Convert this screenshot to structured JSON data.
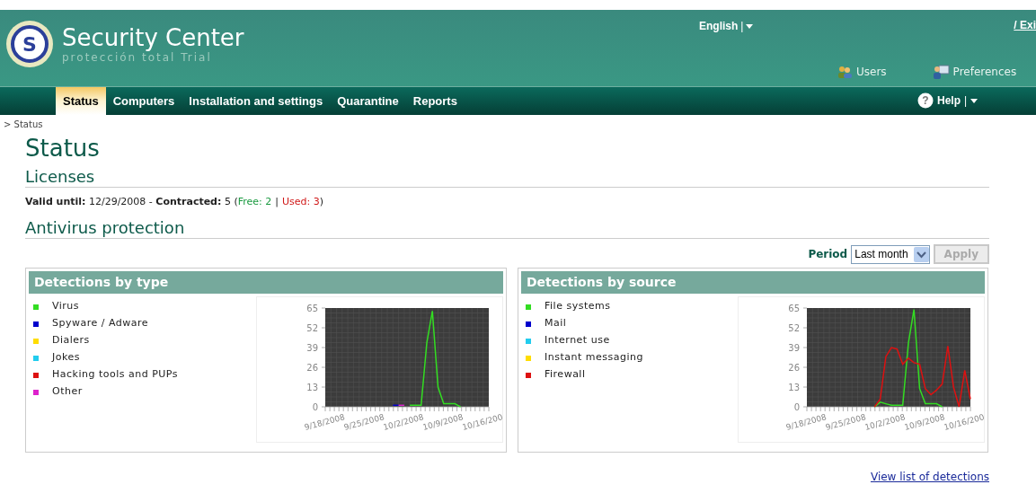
{
  "header": {
    "logo_letter": "S",
    "title": "Security Center",
    "subtitle": "protección total Trial",
    "language": "English",
    "language_separator": "|",
    "exit_link": "/ Exi",
    "tools": [
      {
        "label": "Users",
        "kind": "users"
      },
      {
        "label": "Preferences",
        "kind": "preferences"
      }
    ],
    "help_icon": "?",
    "help": "Help",
    "help_separator": "|"
  },
  "nav": [
    {
      "label": "Status",
      "selected": true
    },
    {
      "label": "Computers",
      "selected": false
    },
    {
      "label": "Installation and settings",
      "selected": false
    },
    {
      "label": "Quarantine",
      "selected": false
    },
    {
      "label": "Reports",
      "selected": false
    }
  ],
  "breadcrumb": "> Status",
  "page_title": "Status",
  "licenses": {
    "heading": "Licenses",
    "line": "**Valid until:** 12/29/2008 - **Contracted:** 5 (",
    "free": "Free: 2",
    "separator": "|",
    "used": "Used: 3",
    "close": ")"
  },
  "antivirus": {
    "heading": "Antivirus protection",
    "period_label": "Period",
    "period_value": "Last month",
    "apply": "Apply",
    "apply_disabled": true
  },
  "panels": [
    {
      "title": "Detections by type",
      "chart_data": {
        "type": "line",
        "categories": [
          "9/18/2008",
          null,
          null,
          null,
          null,
          null,
          null,
          "9/25/2008",
          null,
          null,
          null,
          null,
          null,
          null,
          "10/2/2008",
          null,
          null,
          null,
          null,
          null,
          null,
          "10/9/2008",
          null,
          null,
          null,
          null,
          null,
          null,
          "10/16/200",
          null
        ],
        "ylim": [
          0,
          65
        ],
        "yticks": [
          0,
          13,
          26,
          39,
          52,
          65
        ],
        "grid": true,
        "series": [
          {
            "name": "Virus",
            "color": "#33dd22",
            "values": [
              null,
              null,
              null,
              null,
              null,
              null,
              null,
              null,
              null,
              null,
              null,
              null,
              null,
              null,
              null,
              1,
              1,
              1,
              42,
              63,
              13,
              2,
              2,
              2,
              0,
              null,
              null,
              null,
              null,
              null
            ]
          },
          {
            "name": "Spyware / Adware",
            "color": "#0000cc",
            "values": [
              null,
              null,
              null,
              null,
              null,
              null,
              null,
              null,
              null,
              null,
              null,
              null,
              1,
              1,
              null,
              null,
              null,
              null,
              null,
              null,
              null,
              null,
              null,
              null,
              null,
              null,
              null,
              null,
              null,
              null
            ]
          },
          {
            "name": "Dialers",
            "color": "#ffdd00",
            "values": [
              null,
              null,
              null,
              null,
              null,
              null,
              null,
              null,
              null,
              null,
              null,
              null,
              null,
              null,
              null,
              null,
              null,
              null,
              null,
              null,
              null,
              null,
              null,
              null,
              null,
              null,
              null,
              null,
              null,
              null
            ]
          },
          {
            "name": "Jokes",
            "color": "#22ccee",
            "values": [
              null,
              null,
              null,
              null,
              null,
              null,
              null,
              null,
              null,
              null,
              null,
              null,
              null,
              null,
              null,
              null,
              null,
              null,
              null,
              null,
              null,
              null,
              null,
              null,
              null,
              null,
              null,
              null,
              null,
              null
            ]
          },
          {
            "name": "Hacking tools and PUPs",
            "color": "#dd1111",
            "values": [
              null,
              null,
              null,
              null,
              null,
              null,
              null,
              null,
              null,
              null,
              null,
              null,
              null,
              null,
              null,
              null,
              null,
              null,
              null,
              null,
              null,
              null,
              null,
              null,
              null,
              null,
              null,
              null,
              null,
              null
            ]
          },
          {
            "name": "Other",
            "color": "#dd22cc",
            "values": [
              null,
              null,
              null,
              null,
              null,
              null,
              null,
              null,
              null,
              null,
              null,
              null,
              null,
              1,
              1,
              null,
              null,
              null,
              null,
              null,
              null,
              null,
              null,
              null,
              null,
              null,
              null,
              null,
              null,
              null
            ]
          }
        ]
      }
    },
    {
      "title": "Detections by source",
      "chart_data": {
        "type": "line",
        "categories": [
          "9/18/2008",
          null,
          null,
          null,
          null,
          null,
          null,
          "9/25/2008",
          null,
          null,
          null,
          null,
          null,
          null,
          "10/2/2008",
          null,
          null,
          null,
          null,
          null,
          null,
          "10/9/2008",
          null,
          null,
          null,
          null,
          null,
          null,
          "10/16/200",
          null
        ],
        "ylim": [
          0,
          65
        ],
        "yticks": [
          0,
          13,
          26,
          39,
          52,
          65
        ],
        "grid": true,
        "series": [
          {
            "name": "File systems",
            "color": "#33dd22",
            "values": [
              null,
              null,
              null,
              null,
              null,
              null,
              null,
              null,
              null,
              null,
              null,
              null,
              0,
              3,
              2,
              1,
              1,
              1,
              42,
              64,
              12,
              2,
              2,
              2,
              0,
              null,
              null,
              null,
              null,
              null
            ]
          },
          {
            "name": "Mail",
            "color": "#0000cc",
            "values": [
              null,
              null,
              null,
              null,
              null,
              null,
              null,
              null,
              null,
              null,
              null,
              null,
              null,
              null,
              null,
              null,
              null,
              null,
              null,
              null,
              null,
              null,
              null,
              null,
              null,
              null,
              null,
              null,
              null,
              null
            ]
          },
          {
            "name": "Internet use",
            "color": "#22ccee",
            "values": [
              null,
              null,
              null,
              null,
              null,
              null,
              null,
              null,
              null,
              null,
              null,
              null,
              null,
              null,
              null,
              null,
              null,
              null,
              null,
              null,
              null,
              null,
              null,
              null,
              null,
              null,
              null,
              null,
              null,
              null
            ]
          },
          {
            "name": "Instant messaging",
            "color": "#ffdd00",
            "values": [
              null,
              null,
              null,
              null,
              null,
              null,
              null,
              null,
              null,
              null,
              null,
              null,
              null,
              null,
              null,
              null,
              null,
              null,
              null,
              null,
              null,
              null,
              null,
              null,
              null,
              null,
              null,
              null,
              null,
              null
            ]
          },
          {
            "name": "Firewall",
            "color": "#dd1111",
            "values": [
              null,
              null,
              null,
              null,
              null,
              null,
              null,
              null,
              null,
              null,
              null,
              null,
              0,
              5,
              33,
              39,
              38,
              28,
              32,
              29,
              28,
              12,
              8,
              11,
              15,
              40,
              13,
              0,
              24,
              5
            ]
          }
        ]
      }
    }
  ],
  "footer_link": "View list of detections"
}
